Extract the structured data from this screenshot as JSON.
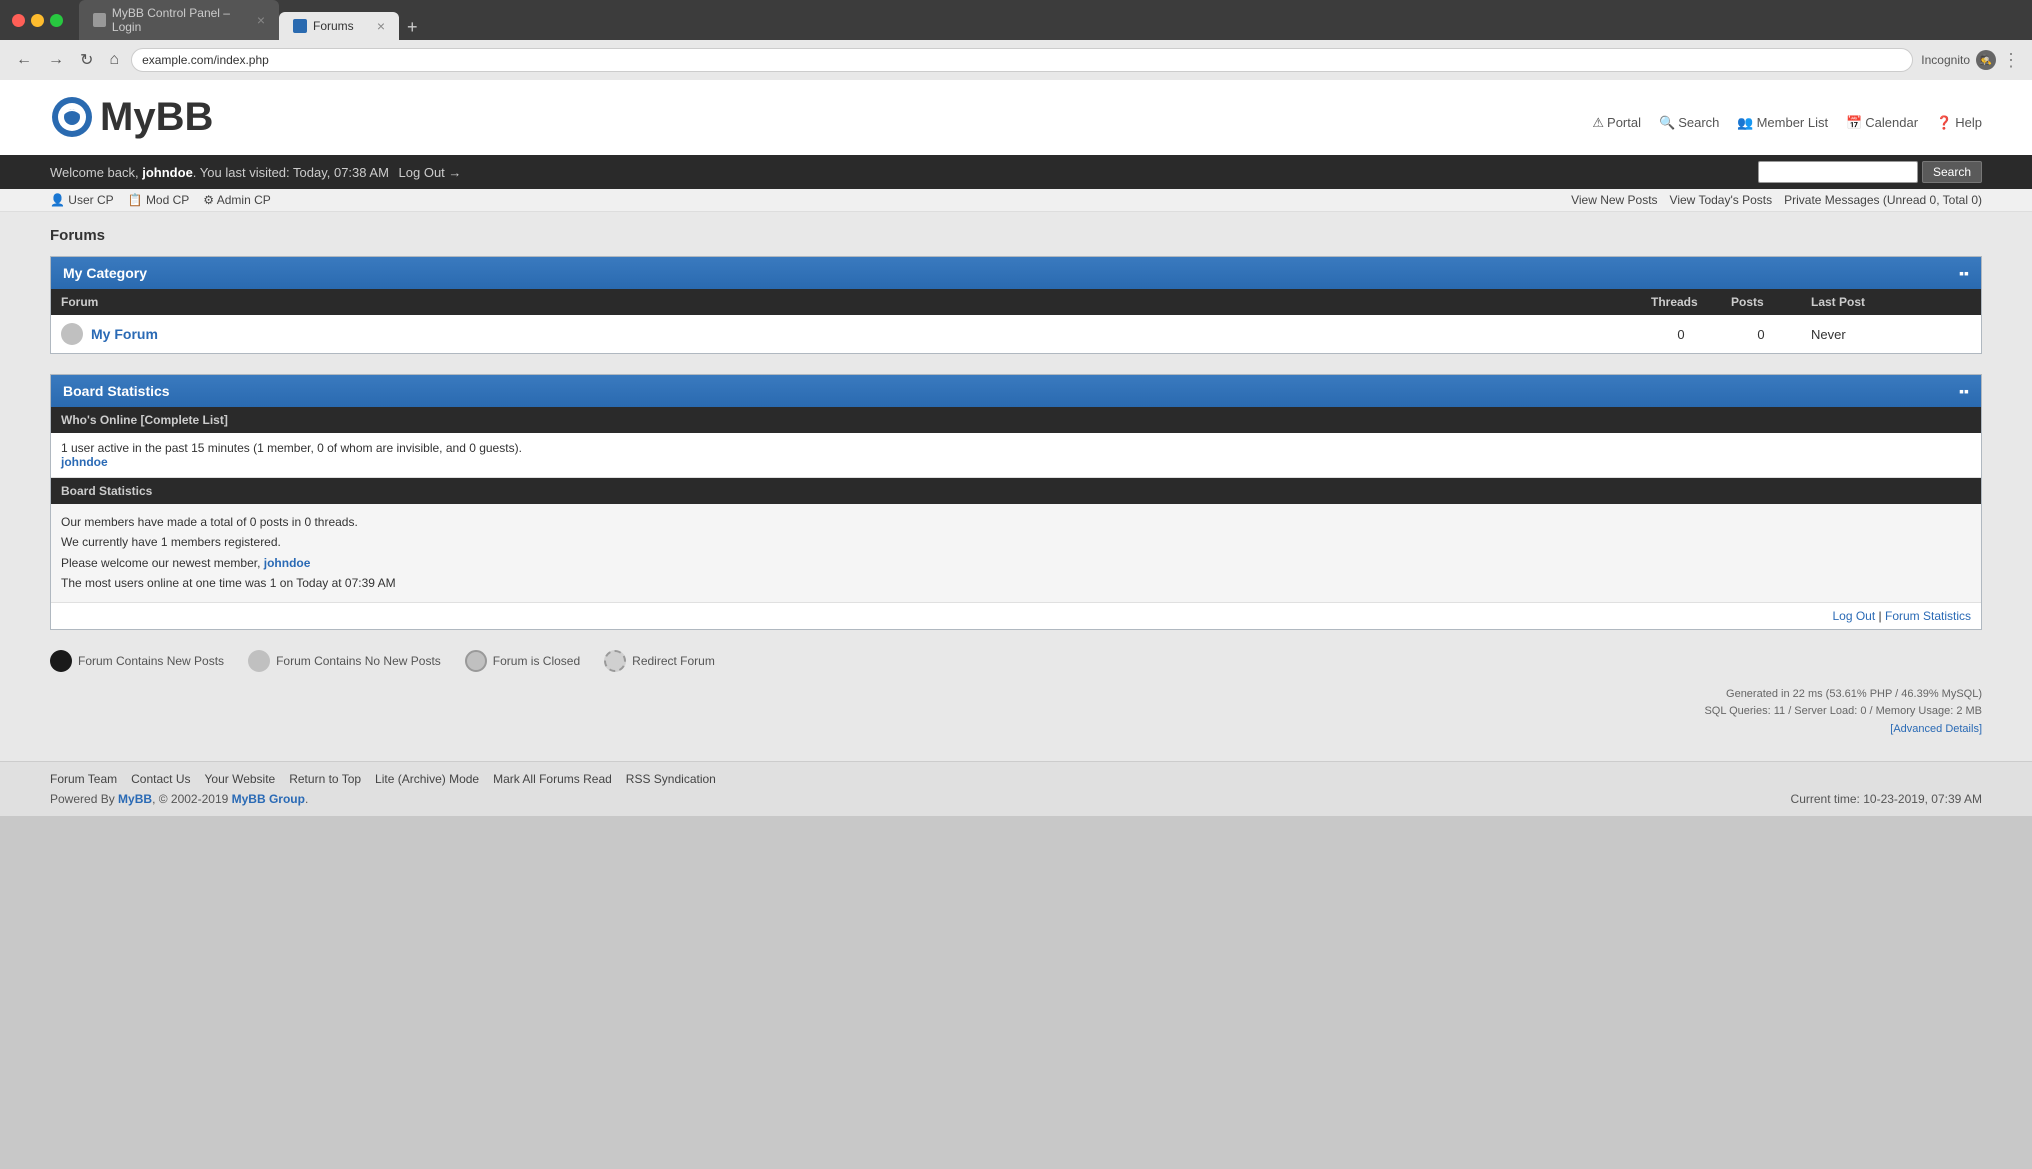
{
  "browser": {
    "tabs": [
      {
        "id": "tab1",
        "label": "MyBB Control Panel – Login",
        "active": false,
        "favicon": "gear"
      },
      {
        "id": "tab2",
        "label": "Forums",
        "active": true,
        "favicon": "forum"
      }
    ],
    "address": "example.com/index.php",
    "incognito_label": "Incognito"
  },
  "header": {
    "logo_text": "MyBB",
    "nav": [
      {
        "id": "portal",
        "icon": "⚠",
        "label": "Portal"
      },
      {
        "id": "search",
        "icon": "🔍",
        "label": "Search"
      },
      {
        "id": "member-list",
        "icon": "👥",
        "label": "Member List"
      },
      {
        "id": "calendar",
        "icon": "📅",
        "label": "Calendar"
      },
      {
        "id": "help",
        "icon": "❓",
        "label": "Help"
      }
    ]
  },
  "welcome_bar": {
    "welcome_text": "Welcome back, ",
    "username": "johndoe",
    "last_visited": "You last visited: Today, 07:38 AM",
    "logout_label": "Log Out",
    "logout_arrow": "→",
    "search_placeholder": "",
    "search_btn_label": "Search"
  },
  "sub_nav": {
    "left": [
      {
        "id": "user-cp",
        "icon": "👤",
        "label": "User CP"
      },
      {
        "id": "mod-cp",
        "icon": "📋",
        "label": "Mod CP"
      },
      {
        "id": "admin-cp",
        "icon": "⚙",
        "label": "Admin CP"
      }
    ],
    "right": [
      {
        "id": "view-new-posts",
        "label": "View New Posts"
      },
      {
        "id": "view-todays-posts",
        "label": "View Today's Posts"
      },
      {
        "id": "private-messages",
        "label": "Private Messages (Unread 0, Total 0)"
      }
    ]
  },
  "page": {
    "title": "Forums",
    "my_category": {
      "section_title": "My Category",
      "columns": [
        {
          "id": "forum",
          "label": "Forum"
        },
        {
          "id": "threads",
          "label": "Threads"
        },
        {
          "id": "posts",
          "label": "Posts"
        },
        {
          "id": "last-post",
          "label": "Last Post"
        }
      ],
      "forums": [
        {
          "id": "my-forum",
          "icon_active": false,
          "name": "My Forum",
          "threads": "0",
          "posts": "0",
          "last_post": "Never"
        }
      ]
    },
    "board_statistics": {
      "section_title": "Board Statistics",
      "whos_online_title": "Who's Online [Complete List]",
      "whos_online_text": "1 user active in the past 15 minutes (1 member, 0 of whom are invisible, and 0 guests).",
      "whos_online_user": "johndoe",
      "board_stats_title": "Board Statistics",
      "stats_lines": [
        "Our members have made a total of 0 posts in 0 threads.",
        "We currently have 1 members registered.",
        "Please welcome our newest member, {johndoe}",
        "The most users online at one time was 1 on Today at 07:39 AM"
      ],
      "newest_member": "johndoe",
      "footer_logout": "Log Out",
      "footer_separator": "|",
      "footer_forum_statistics": "Forum Statistics"
    },
    "legend": [
      {
        "id": "new-posts",
        "icon_type": "black",
        "label": "Forum Contains New Posts"
      },
      {
        "id": "no-new-posts",
        "icon_type": "gray",
        "label": "Forum Contains No New Posts"
      },
      {
        "id": "closed",
        "icon_type": "closed",
        "label": "Forum is Closed"
      },
      {
        "id": "redirect",
        "icon_type": "redirect",
        "label": "Redirect Forum"
      }
    ],
    "gen_info": {
      "line1": "Generated in 22 ms (53.61% PHP / 46.39% MySQL)",
      "line2": "SQL Queries: 11 / Server Load: 0 / Memory Usage: 2 MB",
      "advanced_details": "[Advanced Details]"
    }
  },
  "footer": {
    "links": [
      {
        "id": "forum-team",
        "label": "Forum Team"
      },
      {
        "id": "contact-us",
        "label": "Contact Us"
      },
      {
        "id": "your-website",
        "label": "Your Website"
      },
      {
        "id": "return-to-top",
        "label": "Return to Top"
      },
      {
        "id": "lite-mode",
        "label": "Lite (Archive) Mode"
      },
      {
        "id": "mark-all-read",
        "label": "Mark All Forums Read"
      },
      {
        "id": "rss",
        "label": "RSS Syndication"
      }
    ],
    "powered_by_pre": "Powered By ",
    "powered_by_name": "MyBB",
    "powered_by_post": ", © 2002-2019 ",
    "powered_by_group": "MyBB Group",
    "powered_by_period": ".",
    "current_time_label": "Current time:",
    "current_time_value": "10-23-2019, 07:39 AM"
  }
}
